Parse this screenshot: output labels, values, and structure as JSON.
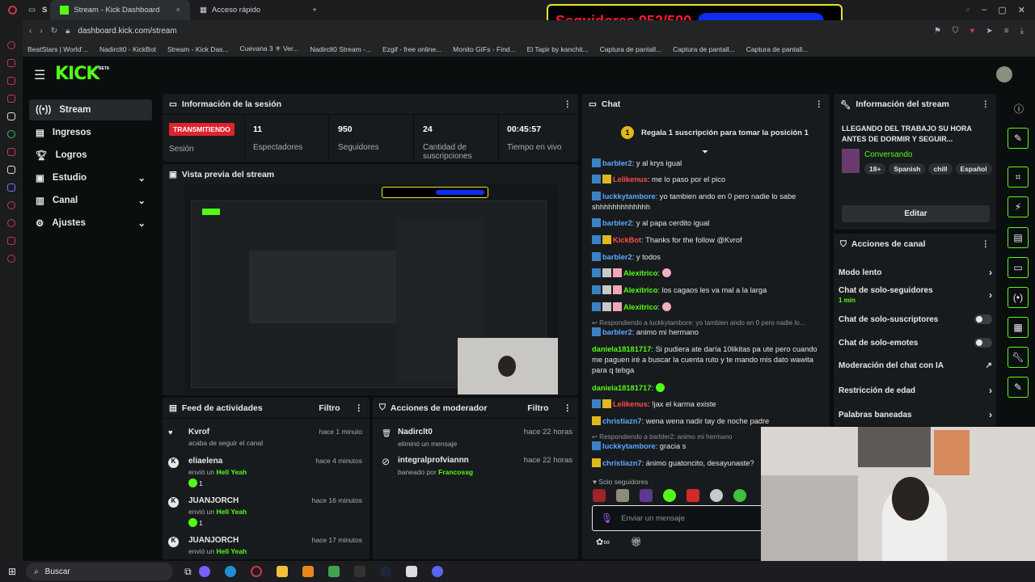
{
  "browser": {
    "tabs": [
      "Stream - Kick Dashboard",
      "Acceso rápido"
    ],
    "url": "dashboard.kick.com/stream",
    "bookmarks": [
      "BeatStars | World'...",
      "Nadirclt0 - KickBot",
      "Stream - Kick Das...",
      "Cuevana 3 ⚜ Ver...",
      "Nadirclt0 Stream -...",
      "Ezgif - free online...",
      "Monito GIFs - Find...",
      "El Tapir by kanchit...",
      "Captura de pantall...",
      "Captura de pantall...",
      "Captura de pantall..."
    ]
  },
  "overlay": {
    "followers_label": "Seguidores 952/500",
    "progress": 1.0
  },
  "kick": {
    "logo": "KICK",
    "beta": "BETA"
  },
  "nav": [
    {
      "label": "Stream"
    },
    {
      "label": "Ingresos"
    },
    {
      "label": "Logros"
    },
    {
      "label": "Estudio"
    },
    {
      "label": "Canal"
    },
    {
      "label": "Ajustes"
    }
  ],
  "session": {
    "title": "Información de la sesión",
    "badge": "TRANSMITIENDO",
    "badge_caption": "Sesión",
    "stats": [
      {
        "value": "11",
        "label": "Espectadores"
      },
      {
        "value": "950",
        "label": "Seguidores"
      },
      {
        "value": "24",
        "label": "Cantidad de suscripciones"
      },
      {
        "value": "00:45:57",
        "label": "Tiempo en vivo"
      }
    ]
  },
  "preview": {
    "title": "Vista previa del stream"
  },
  "feed": {
    "title": "Feed de actividades",
    "filter": "Filtro",
    "items": [
      {
        "user": "Kvrof",
        "action": "acaba de seguir el canal",
        "time": "hace 1 minuto"
      },
      {
        "user": "eliaelena",
        "action": "envió un",
        "item": "Hell Yeah",
        "count": "1",
        "time": "hace 4 minutos"
      },
      {
        "user": "JUANJORCH",
        "action": "envió un",
        "item": "Hell Yeah",
        "count": "1",
        "time": "hace 16 minutos"
      },
      {
        "user": "JUANJORCH",
        "action": "envió un",
        "item": "Hell Yeah",
        "time": "hace 17 minutos"
      }
    ]
  },
  "mod": {
    "title": "Acciones de moderador",
    "filter": "Filtro",
    "items": [
      {
        "user": "Nadirclt0",
        "action": "eliminó un mensaje",
        "time": "hace 22 horas"
      },
      {
        "user": "integralprofviannn",
        "action": "baneado por",
        "by": "Francossg",
        "time": "hace 22 horas"
      }
    ]
  },
  "chat": {
    "title": "Chat",
    "pinned_rank": "1",
    "pinned": "Regala 1 suscripción para tomar la posición 1",
    "lines": [
      {
        "user": "barbler2",
        "color": "#5aa9ff",
        "text": ": y al krys igual"
      },
      {
        "user": "Lelikenus",
        "color": "#ff4d4d",
        "text": ": me lo paso por el pico"
      },
      {
        "user": "luckkytambore",
        "color": "#5aa9ff",
        "text": ": yo tambien ando en 0 pero nadie lo sabe shhhhhhhhhhhhh"
      },
      {
        "user": "barbler2",
        "color": "#5aa9ff",
        "text": ": y al papa cerdito igual"
      },
      {
        "user": "KickBot",
        "color": "#ff4d4d",
        "text": ": Thanks for the follow @Kvrof"
      },
      {
        "user": "barbler2",
        "color": "#5aa9ff",
        "text": ": y todos"
      },
      {
        "user": "Alexitrico",
        "color": "#53fc18",
        "text": ":"
      },
      {
        "user": "Alexitrico",
        "color": "#53fc18",
        "text": ": los cagaos les va mal a la larga"
      },
      {
        "user": "Alexitrico",
        "color": "#53fc18",
        "text": ":"
      },
      {
        "reply": "Respondiendo a luckkytambore: yo tambien ando en 0 pero nadie lo..."
      },
      {
        "user": "barbler2",
        "color": "#5aa9ff",
        "text": ": animo mi hermano"
      },
      {
        "user": "daniela18181717",
        "color": "#53fc18",
        "text": ": Si pudiera ate daría 10likitas pa ute pero cuando me paguen iré a buscar la cuenta ruto y te mando mis dato wawita para q tebga"
      },
      {
        "user": "daniela18181717",
        "color": "#53fc18",
        "text": ":"
      },
      {
        "user": "Lelikenus",
        "color": "#ff4d4d",
        "text": ": !jax el karma existe"
      },
      {
        "user": "christiazn7",
        "color": "#5aa9ff",
        "text": ": wena wena nadir tay de noche padre"
      },
      {
        "reply": "Respondiendo a barbler2: animo mi hermano"
      },
      {
        "user": "luckkytambore",
        "color": "#5aa9ff",
        "text": ": gracia s"
      },
      {
        "user": "christiazn7",
        "color": "#5aa9ff",
        "text": ": ánimo guatoncito, desayunaste?"
      }
    ],
    "followers_only": "Solo seguidores",
    "input_placeholder": "Enviar un mensaje"
  },
  "stream_info": {
    "title": "Información del stream",
    "stream_title": "LLEGANDO DEL TRABAJO SU HORA ANTES DE DORMIR Y SEGUIR...",
    "category": "Conversando",
    "tags": [
      "18+",
      "Spanish",
      "chill",
      "Español"
    ],
    "edit": "Editar"
  },
  "channel_actions": {
    "title": "Acciones de canal",
    "items": [
      {
        "label": "Modo lento",
        "control": "chevron"
      },
      {
        "label": "Chat de solo-seguidores",
        "sub": "1 min",
        "control": "chevron"
      },
      {
        "label": "Chat de solo-suscriptores",
        "control": "toggle"
      },
      {
        "label": "Chat de solo-emotes",
        "control": "toggle"
      },
      {
        "label": "Moderación del chat con IA",
        "control": "external"
      },
      {
        "label": "Restricción de edad",
        "control": "chevron"
      },
      {
        "label": "Palabras baneadas",
        "control": "chevron"
      }
    ]
  },
  "taskbar": {
    "search": "Buscar"
  }
}
